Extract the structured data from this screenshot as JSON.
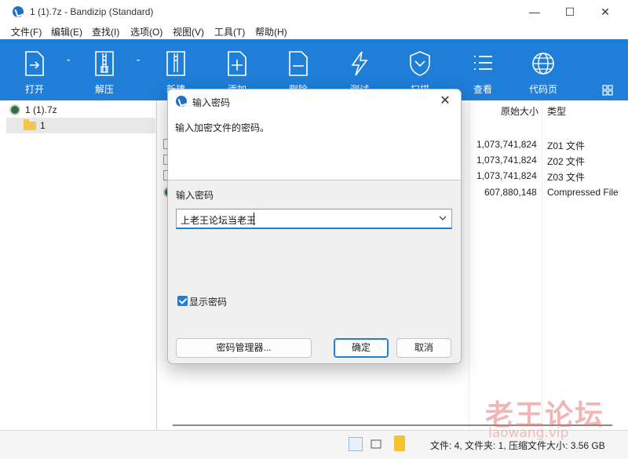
{
  "window": {
    "title": "1 (1).7z - Bandizip (Standard)"
  },
  "titlebar": {
    "minimize": "—",
    "maximize": "☐",
    "close": "✕"
  },
  "menu": [
    "文件(F)",
    "编辑(E)",
    "查找(I)",
    "选项(O)",
    "视图(V)",
    "工具(T)",
    "帮助(H)"
  ],
  "toolbar": {
    "items": [
      {
        "label": "打开",
        "icon": "open-icon"
      },
      {
        "label": "解压",
        "icon": "extract-icon"
      },
      {
        "label": "新建",
        "icon": "new-archive-icon"
      },
      {
        "label": "添加",
        "icon": "add-icon"
      },
      {
        "label": "删除",
        "icon": "delete-icon"
      },
      {
        "label": "测试",
        "icon": "test-icon"
      },
      {
        "label": "扫描",
        "icon": "scan-icon"
      },
      {
        "label": "查看",
        "icon": "view-icon"
      },
      {
        "label": "代码页",
        "icon": "codepage-icon"
      }
    ]
  },
  "tree": {
    "root": "1 (1).7z",
    "children": [
      "1"
    ]
  },
  "filelist": {
    "columns": {
      "original_size": "原始大小",
      "type": "类型"
    },
    "rows": [
      {
        "size": "1,073,741,824",
        "type": "Z01 文件"
      },
      {
        "size": "1,073,741,824",
        "type": "Z02 文件"
      },
      {
        "size": "1,073,741,824",
        "type": "Z03 文件"
      },
      {
        "size": "607,880,148",
        "type": "Compressed File"
      }
    ]
  },
  "status": {
    "text": "文件: 4, 文件夹: 1, 压缩文件大小: 3.56 GB"
  },
  "watermark": {
    "main": "老王论坛",
    "sub": "laowang.vip"
  },
  "dialog": {
    "title": "输入密码",
    "prompt": "输入加密文件的密码。",
    "password_label": "输入密码",
    "password_value": "上老王论坛当老王",
    "show_password_label": "显示密码",
    "show_password_checked": true,
    "buttons": {
      "manager": "密码管理器...",
      "ok": "确定",
      "cancel": "取消"
    }
  },
  "colors": {
    "toolbar_bg": "#1e7ed8",
    "accent": "#1e7ed8"
  }
}
